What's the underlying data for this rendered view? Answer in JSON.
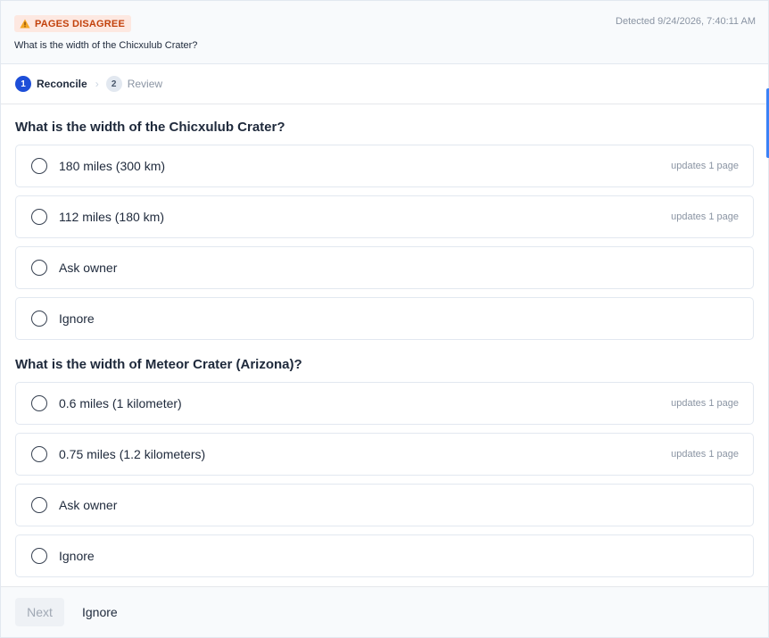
{
  "header": {
    "badge_label": "PAGES DISAGREE",
    "badge_icon": "warning-icon",
    "detected": "Detected 9/24/2026, 7:40:11 AM",
    "subtitle": "What is the width of the Chicxulub Crater?"
  },
  "stepper": {
    "steps": [
      {
        "number": "1",
        "label": "Reconcile",
        "state": "active"
      },
      {
        "number": "2",
        "label": "Review",
        "state": "inactive"
      }
    ],
    "separator": "›"
  },
  "questions": [
    {
      "title": "What is the width of the Chicxulub Crater?",
      "options": [
        {
          "label": "180 miles (300 km)",
          "meta": "updates 1 page"
        },
        {
          "label": "112 miles (180 km)",
          "meta": "updates 1 page"
        },
        {
          "label": "Ask owner",
          "meta": ""
        },
        {
          "label": "Ignore",
          "meta": ""
        }
      ]
    },
    {
      "title": "What is the width of Meteor Crater (Arizona)?",
      "options": [
        {
          "label": "0.6 miles (1 kilometer)",
          "meta": "updates 1 page"
        },
        {
          "label": "0.75 miles (1.2 kilometers)",
          "meta": "updates 1 page"
        },
        {
          "label": "Ask owner",
          "meta": ""
        },
        {
          "label": "Ignore",
          "meta": ""
        }
      ]
    }
  ],
  "footer": {
    "next_label": "Next",
    "ignore_label": "Ignore"
  },
  "colors": {
    "accent": "#1d4ed8",
    "badge_bg": "#fde8e1",
    "badge_text": "#c2410c",
    "muted_text": "#8a94a3"
  }
}
